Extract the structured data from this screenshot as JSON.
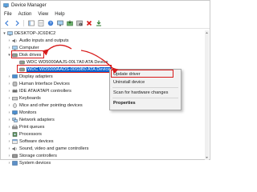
{
  "window": {
    "title": "Device Manager"
  },
  "menus": [
    "File",
    "Action",
    "View",
    "Help"
  ],
  "tree": {
    "root": "DESKTOP-JC6DIC2",
    "items": [
      {
        "label": "Audio inputs and outputs",
        "icon": "speaker-icon"
      },
      {
        "label": "Computer",
        "icon": "computer-icon"
      },
      {
        "label": "Disk drives",
        "icon": "disk-icon"
      },
      {
        "label": "WDC WD5000AAJS-00L7A0 ATA Device",
        "icon": "disk-icon"
      },
      {
        "label": "WDC WD5000AADS-00S9B0 ATA Device",
        "icon": "disk-icon"
      },
      {
        "label": "Display adapters",
        "icon": "display-icon"
      },
      {
        "label": "Human Interface Devices",
        "icon": "hid-icon"
      },
      {
        "label": "IDE ATA/ATAPI controllers",
        "icon": "controller-icon"
      },
      {
        "label": "Keyboards",
        "icon": "keyboard-icon"
      },
      {
        "label": "Mice and other pointing devices",
        "icon": "mouse-icon"
      },
      {
        "label": "Monitors",
        "icon": "monitor-icon"
      },
      {
        "label": "Network adapters",
        "icon": "network-icon"
      },
      {
        "label": "Print queues",
        "icon": "printer-icon"
      },
      {
        "label": "Processors",
        "icon": "processor-icon"
      },
      {
        "label": "Software devices",
        "icon": "software-icon"
      },
      {
        "label": "Sound, video and game controllers",
        "icon": "sound-icon"
      },
      {
        "label": "Storage controllers",
        "icon": "storage-icon"
      },
      {
        "label": "System devices",
        "icon": "system-icon"
      }
    ]
  },
  "context_menu": {
    "items": [
      "Update driver",
      "Uninstall device",
      "Scan for hardware changes",
      "Properties"
    ]
  },
  "colors": {
    "highlight": "#d71a1a",
    "selection": "#0a64d2"
  }
}
